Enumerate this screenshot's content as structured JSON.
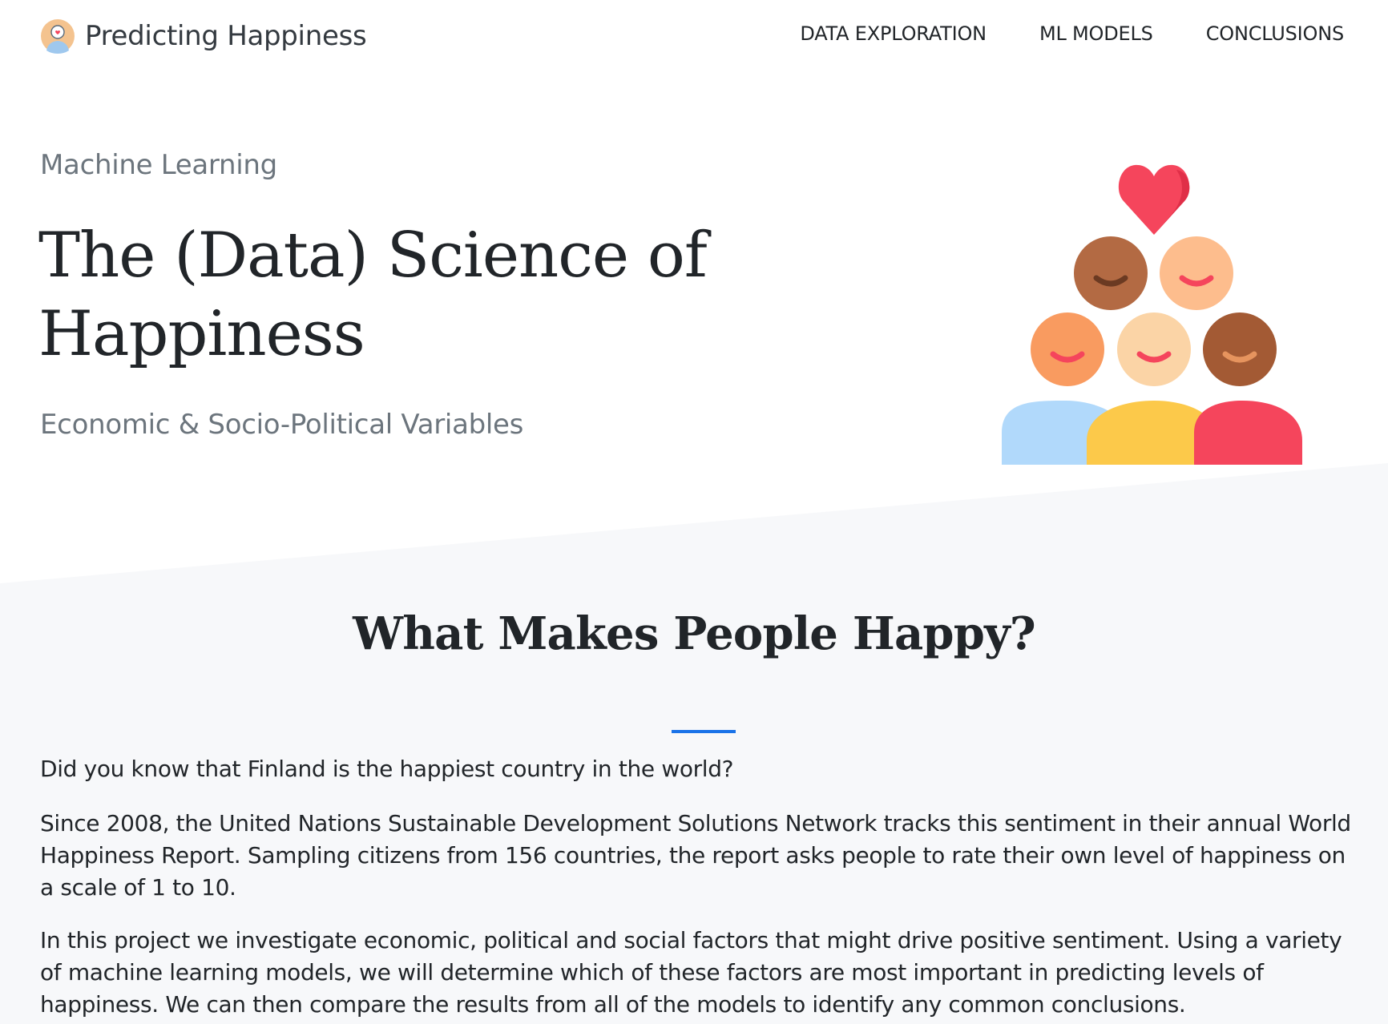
{
  "navbar": {
    "brand": "Predicting Happiness",
    "links": [
      "DATA EXPLORATION",
      "ML MODELS",
      "CONCLUSIONS"
    ]
  },
  "hero": {
    "subtitle": "Machine Learning",
    "title_line1": "The (Data) Science of",
    "title_line2": "Happiness",
    "tagline": "Economic & Socio-Political Variables"
  },
  "section": {
    "title": "What Makes People Happy?",
    "paragraphs": [
      "Did you know that Finland is the happiest country in the world?",
      "Since 2008, the United Nations Sustainable Development Solutions Network tracks this sentiment in their annual World Happiness Report. Sampling citizens from 156 countries, the report asks people to rate their own level of happiness on a scale of 1 to 10.",
      "In this project we investigate economic, political and social factors that might drive positive sentiment. Using a variety of machine learning models, we will determine which of these factors are most important in predicting levels of happiness. We can then compare the results from all of the models to identify any common conclusions."
    ]
  },
  "colors": {
    "accent": "#1a73e8",
    "section_bg": "#f7f8fa",
    "muted_text": "#6c757d",
    "heart": "#f5455c"
  },
  "icons": {
    "brand_logo": "person-with-heart-icon",
    "hero_illustration": "happy-people-group-with-heart-icon"
  }
}
